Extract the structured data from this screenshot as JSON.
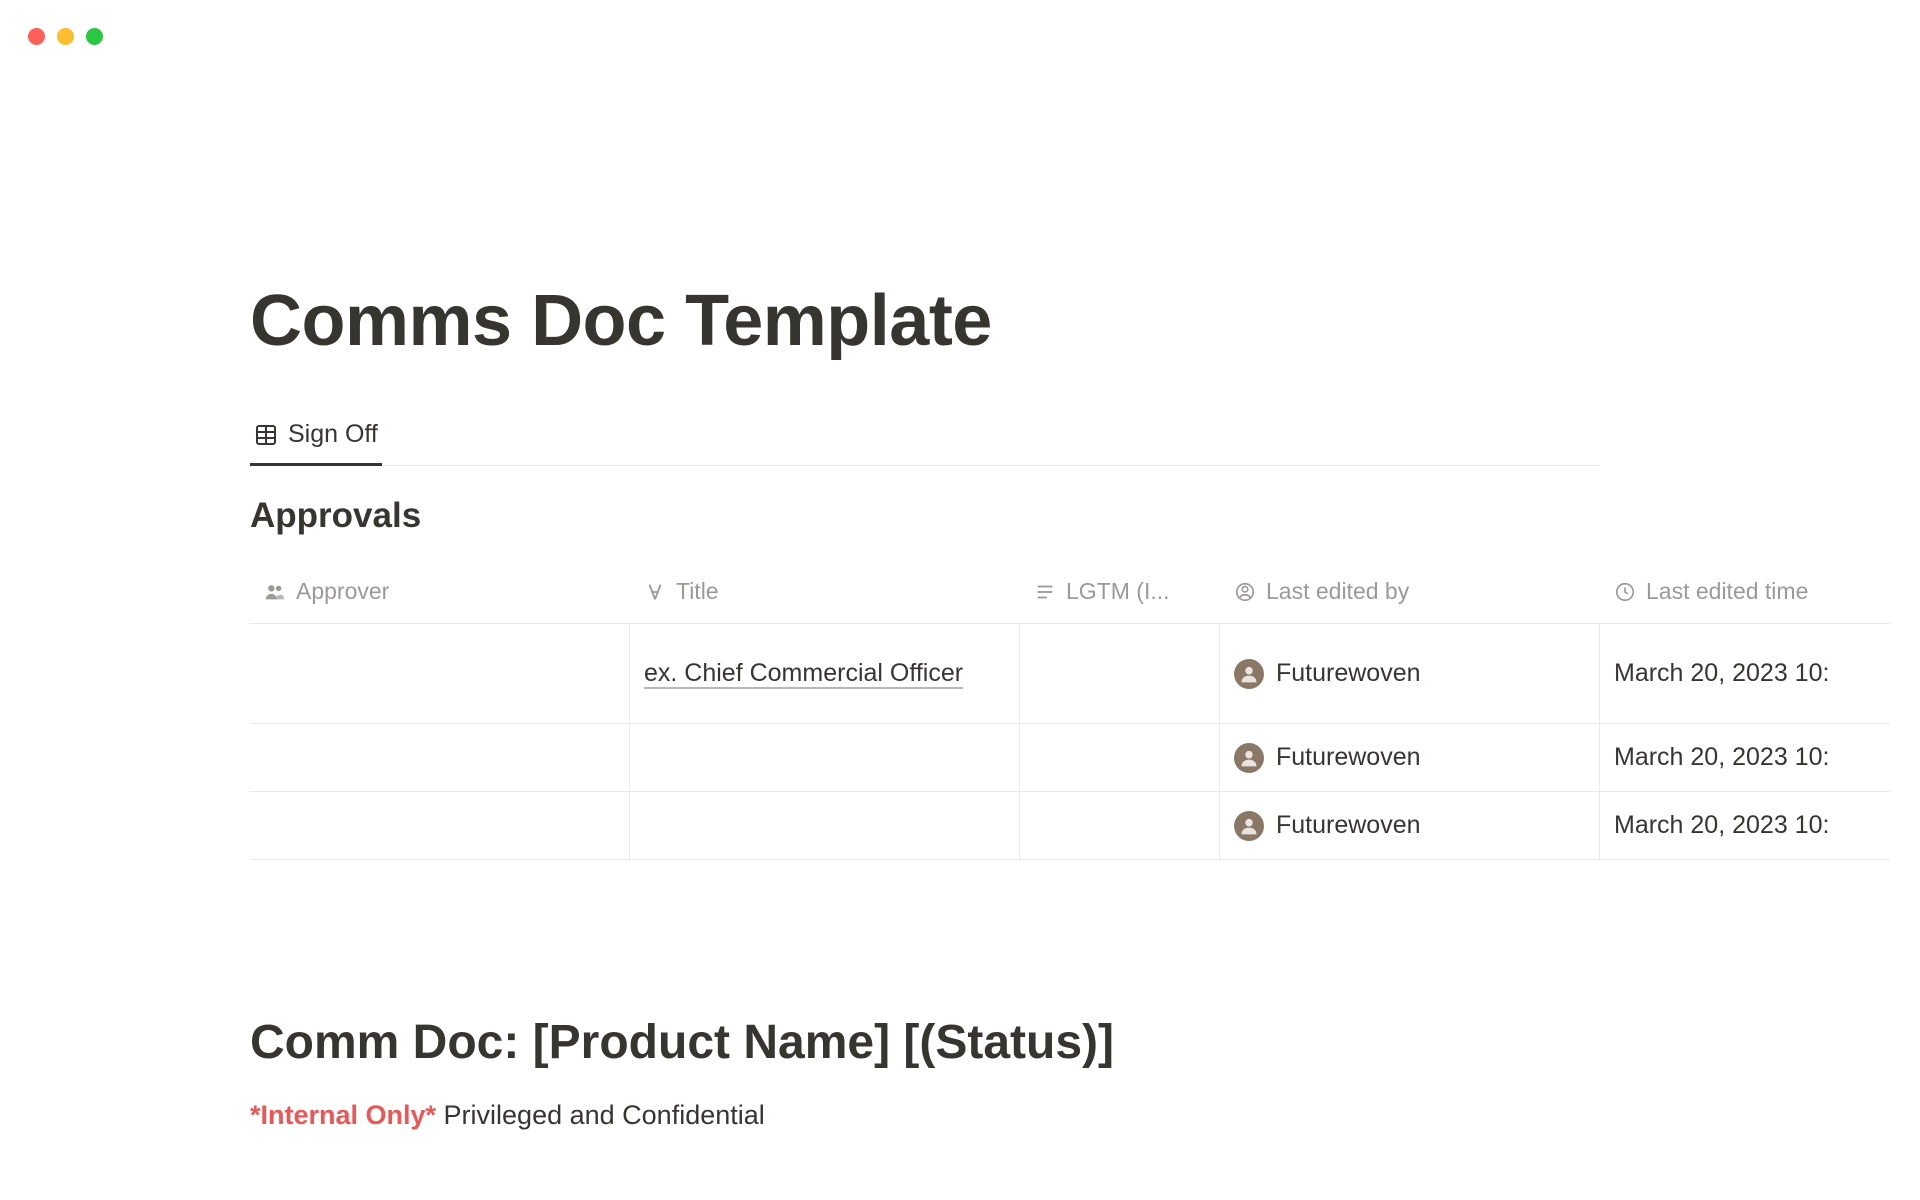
{
  "page": {
    "title": "Comms Doc Template"
  },
  "tab": {
    "label": "Sign Off"
  },
  "section": {
    "title": "Approvals"
  },
  "columns": {
    "approver": "Approver",
    "title": "Title",
    "lgtm": "LGTM (I...",
    "lastedited": "Last edited by",
    "lasttime": "Last edited time"
  },
  "rows": [
    {
      "approver": "",
      "title": "ex. Chief Commercial Officer",
      "lgtm": "",
      "lastedited": "Futurewoven",
      "lasttime": "March 20, 2023 10:"
    },
    {
      "approver": "",
      "title": "",
      "lgtm": "",
      "lastedited": "Futurewoven",
      "lasttime": "March 20, 2023 10:"
    },
    {
      "approver": "",
      "title": "",
      "lgtm": "",
      "lastedited": "Futurewoven",
      "lasttime": "March 20, 2023 10:"
    }
  ],
  "doc": {
    "heading": "Comm Doc: [Product Name] [(Status)]",
    "internal": "*Internal Only*",
    "classification": " Privileged and Confidential"
  }
}
